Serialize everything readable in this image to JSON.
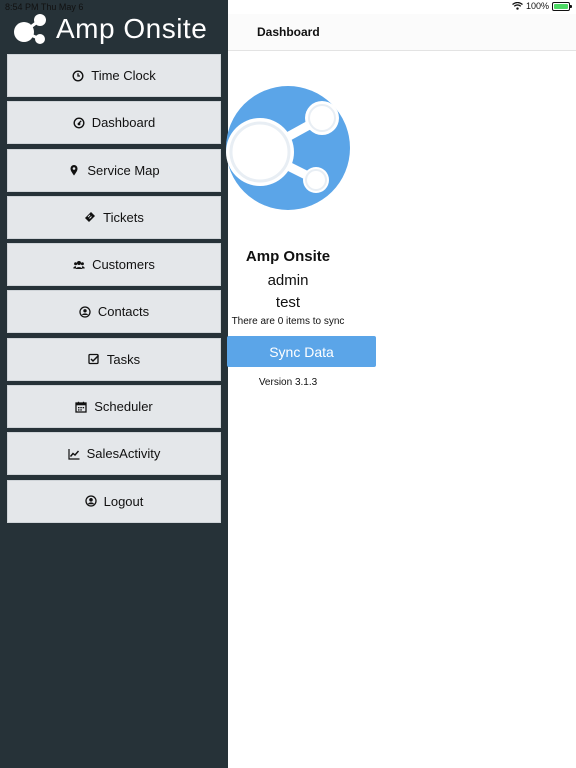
{
  "status_bar": {
    "time": "8:54 PM  Thu May 6",
    "battery": "100%"
  },
  "brand": {
    "name": "Amp Onsite"
  },
  "menu": [
    {
      "label": "Time Clock",
      "icon": "clock-icon"
    },
    {
      "label": "Dashboard",
      "icon": "dashboard-icon"
    },
    {
      "label": "Service Map",
      "icon": "map-pin-icon"
    },
    {
      "label": "Tickets",
      "icon": "ticket-icon"
    },
    {
      "label": "Customers",
      "icon": "users-icon"
    },
    {
      "label": "Contacts",
      "icon": "contact-icon"
    },
    {
      "label": "Tasks",
      "icon": "checkbox-icon"
    },
    {
      "label": "Scheduler",
      "icon": "calendar-icon"
    },
    {
      "label": "SalesActivity",
      "icon": "line-chart-icon"
    },
    {
      "label": "Logout",
      "icon": "user-circle-icon"
    }
  ],
  "header": {
    "title": "Dashboard"
  },
  "dashboard": {
    "app_name": "Amp Onsite",
    "user": "admin",
    "company": "test",
    "sync_info": "There are 0 items to sync",
    "sync_button": "Sync Data",
    "version": "Version 3.1.3"
  },
  "colors": {
    "sidebar": "#263238",
    "menu_item": "#e4e7ea",
    "accent": "#5ba5e8",
    "logo_blue": "#5ba5e8"
  }
}
